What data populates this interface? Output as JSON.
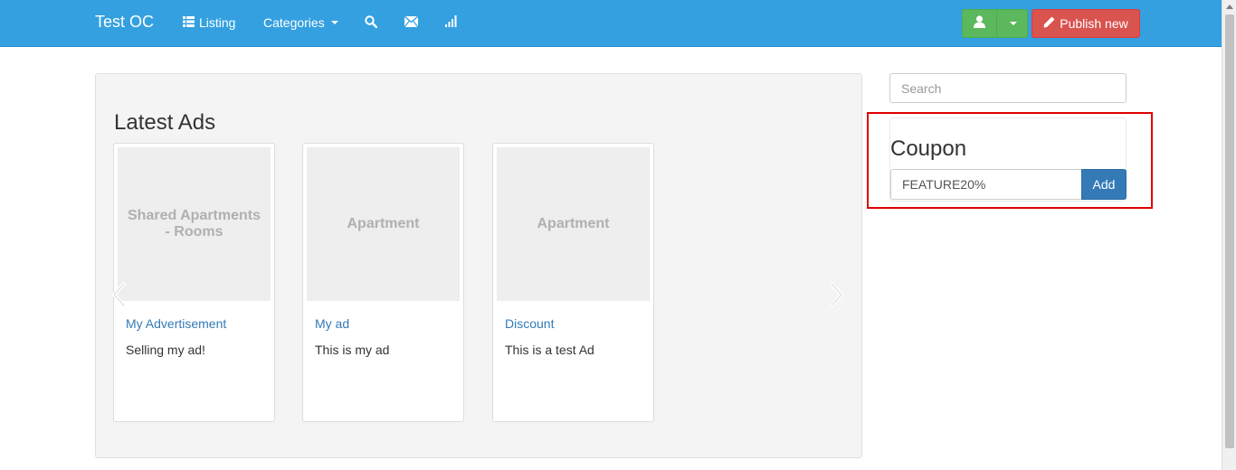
{
  "navbar": {
    "brand": "Test OC",
    "items": [
      {
        "label": "Listing",
        "icon": "list-icon"
      },
      {
        "label": "Categories",
        "icon": "chevron-down-icon"
      },
      {
        "label": "",
        "icon": "search-icon"
      },
      {
        "label": "",
        "icon": "envelope-icon"
      },
      {
        "label": "",
        "icon": "signal-icon"
      }
    ],
    "user_button_icon": "user-icon",
    "publish_label": "Publish new",
    "background_color": "#34a0e0"
  },
  "main": {
    "heading": "Latest Ads",
    "ads": [
      {
        "image_text": "Shared Apartments - Rooms",
        "title": "My Advertisement",
        "description": "Selling my ad!"
      },
      {
        "image_text": "Apartment",
        "title": "My ad",
        "description": "This is my ad"
      },
      {
        "image_text": "Apartment",
        "title": "Discount",
        "description": "This is a test Ad"
      }
    ]
  },
  "sidebar": {
    "search_placeholder": "Search",
    "coupon": {
      "heading": "Coupon",
      "value": "FEATURE20%",
      "add_label": "Add"
    }
  },
  "colors": {
    "success": "#5cb85c",
    "danger": "#d9534f",
    "primary": "#337ab7",
    "highlight": "#e00000"
  }
}
